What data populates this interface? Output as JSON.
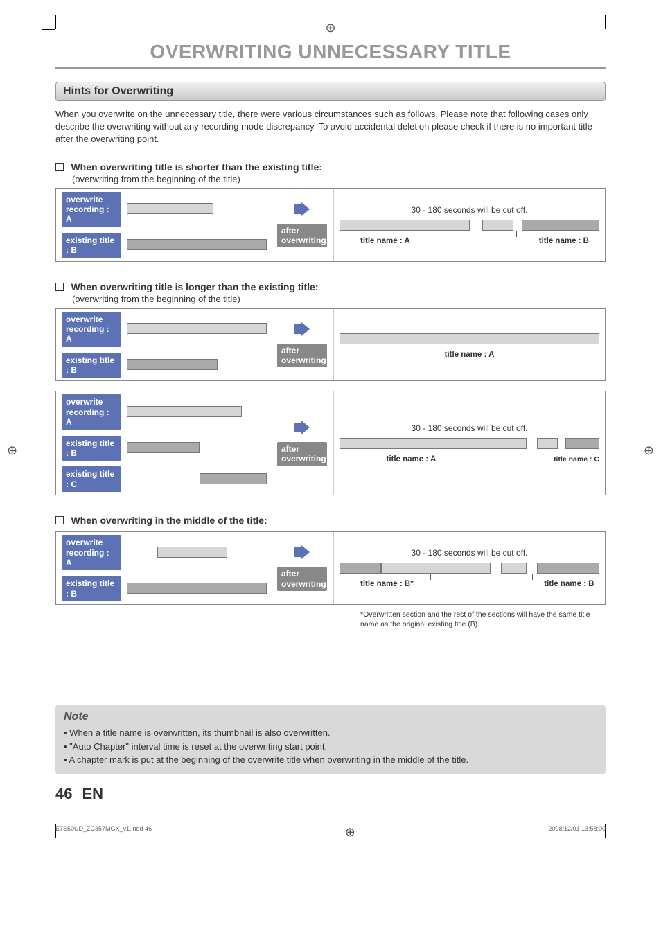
{
  "title": "OVERWRITING UNNECESSARY TITLE",
  "section": "Hints for Overwriting",
  "intro": "When you overwrite on the unnecessary title, there were various circumstances such as follows.  Please note that following cases only describe the overwriting without any recording mode discrepancy.  To avoid accidental deletion please check if there is no important title after the overwriting point.",
  "cases": {
    "shorter": {
      "heading": "When overwriting title is shorter than the existing title:",
      "sub": "(overwriting from the beginning of the title)",
      "left": [
        "overwrite recording : A",
        "existing title : B"
      ],
      "mid": "after overwriting",
      "cutoff": "30 - 180 seconds will be cut off.",
      "caption_a": "title name : A",
      "caption_b": "title name : B"
    },
    "longer": {
      "heading": "When overwriting title is longer than the existing title:",
      "sub": "(overwriting from the beginning of the title)",
      "left": [
        "overwrite recording : A",
        "existing title : B"
      ],
      "mid": "after overwriting",
      "caption_a": "title name : A"
    },
    "longer3": {
      "left": [
        "overwrite recording : A",
        "existing title : B",
        "existing title : C"
      ],
      "mid": "after overwriting",
      "cutoff": "30 - 180 seconds will be cut off.",
      "caption_a": "title name : A",
      "caption_c": "title name : C"
    },
    "middle": {
      "heading": "When overwriting in the middle of the title:",
      "left": [
        "overwrite recording : A",
        "existing title : B"
      ],
      "mid": "after overwriting",
      "cutoff": "30 - 180 seconds will be cut off.",
      "caption_b_star": "title name : B*",
      "caption_b": "title name : B",
      "footnote": "*Overwritten section and the rest of the sections will have the same title name as the original existing title (B)."
    }
  },
  "note": {
    "title": "Note",
    "items": [
      "When a title name is overwritten, its thumbnail is also overwritten.",
      "\"Auto Chapter\" interval time is reset at the overwriting start point.",
      "A chapter mark is put at the beginning of the overwrite title when overwriting in the middle of the title."
    ]
  },
  "page": {
    "num": "46",
    "lang": "EN"
  },
  "footer": {
    "left": "E7S50UD_ZC357MGX_v1.indd   46",
    "right": "2008/12/01   13:58:00"
  },
  "registration": "⊕"
}
